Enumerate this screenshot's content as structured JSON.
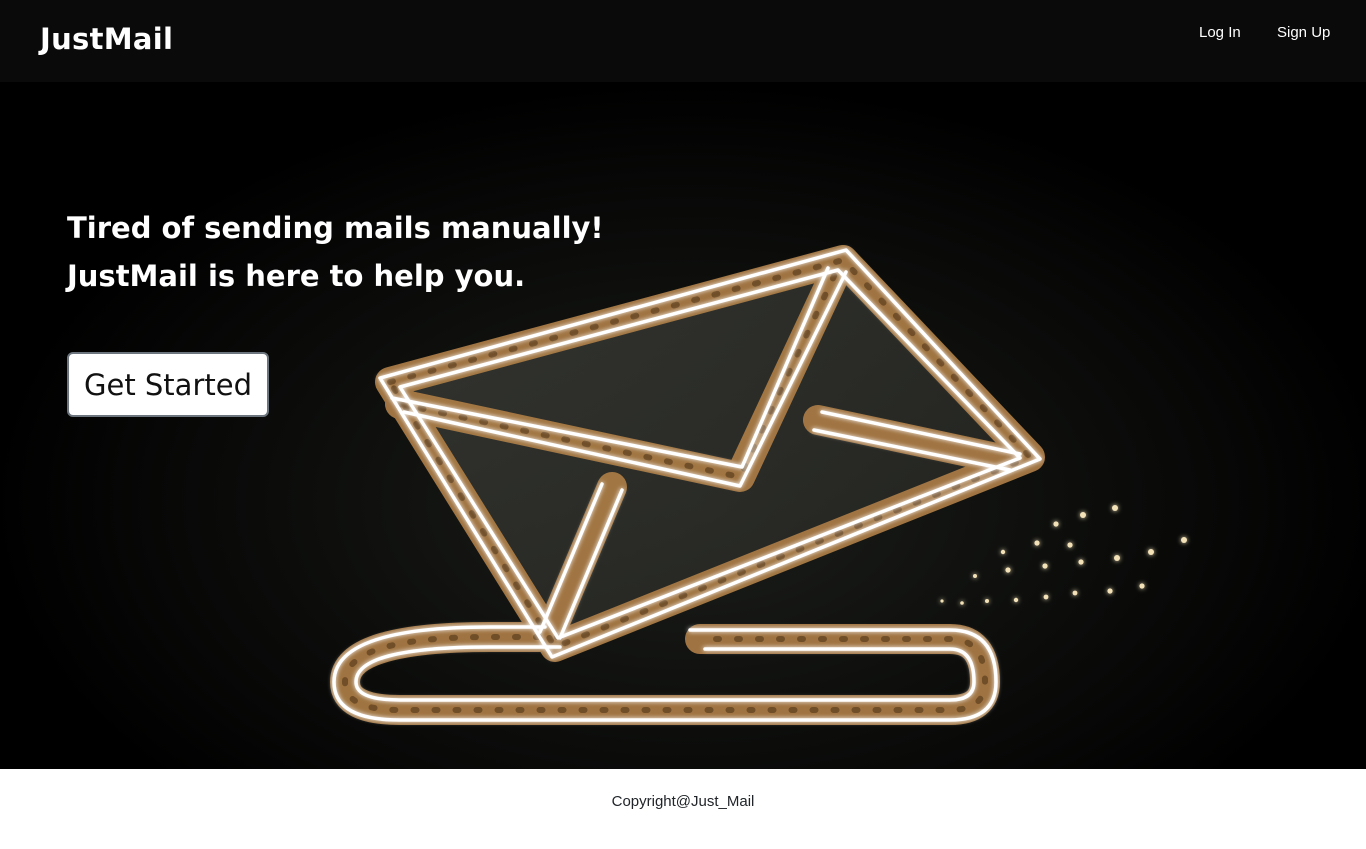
{
  "navbar": {
    "brand": "JustMail",
    "links": [
      {
        "label": "Log In"
      },
      {
        "label": "Sign Up"
      }
    ]
  },
  "hero": {
    "line1": "Tired of sending mails manually!",
    "line2_brand": "JustMail",
    "line2_rest": " is here to help you.",
    "cta_label": "Get Started",
    "background_image": "neon-envelope-sign"
  },
  "footer": {
    "copyright": "Copyright@Just_Mail"
  },
  "colors": {
    "navbar_bg": "#0a0a0a",
    "hero_bg": "#000000",
    "text_on_dark": "#ffffff",
    "cta_bg": "#ffffff",
    "cta_border": "#6c757d",
    "neon_rust": "#b7864a",
    "neon_tube": "#ffffff"
  }
}
